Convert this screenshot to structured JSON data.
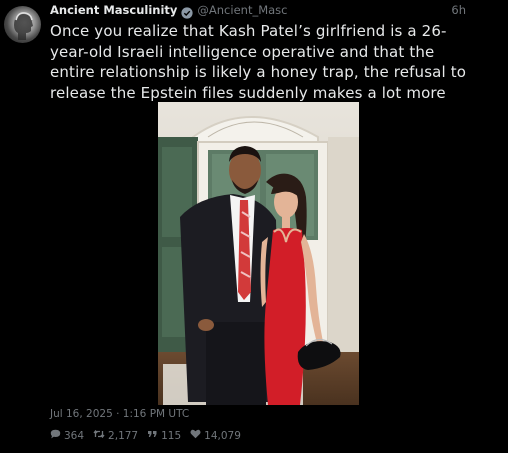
{
  "author": {
    "name": "Ancient Masculinity",
    "handle": "@Ancient_Masc",
    "verified_color": "#8b98a5"
  },
  "relative_time": "6h",
  "tweet_text": "Once you realize that Kash Patel’s girlfriend is a 26-year-old Israeli intelligence operative and that the entire relationship is likely a honey trap, the refusal to release the Epstein files suddenly makes a lot more sense.",
  "timestamp": "Jul 16, 2025 · 1:16 PM UTC",
  "stats": {
    "replies": "364",
    "retweets": "2,177",
    "quotes": "115",
    "likes": "14,079"
  },
  "icons": {
    "replies": "comment-icon",
    "retweets": "retweet-icon",
    "quotes": "quote-icon",
    "likes": "heart-icon"
  }
}
